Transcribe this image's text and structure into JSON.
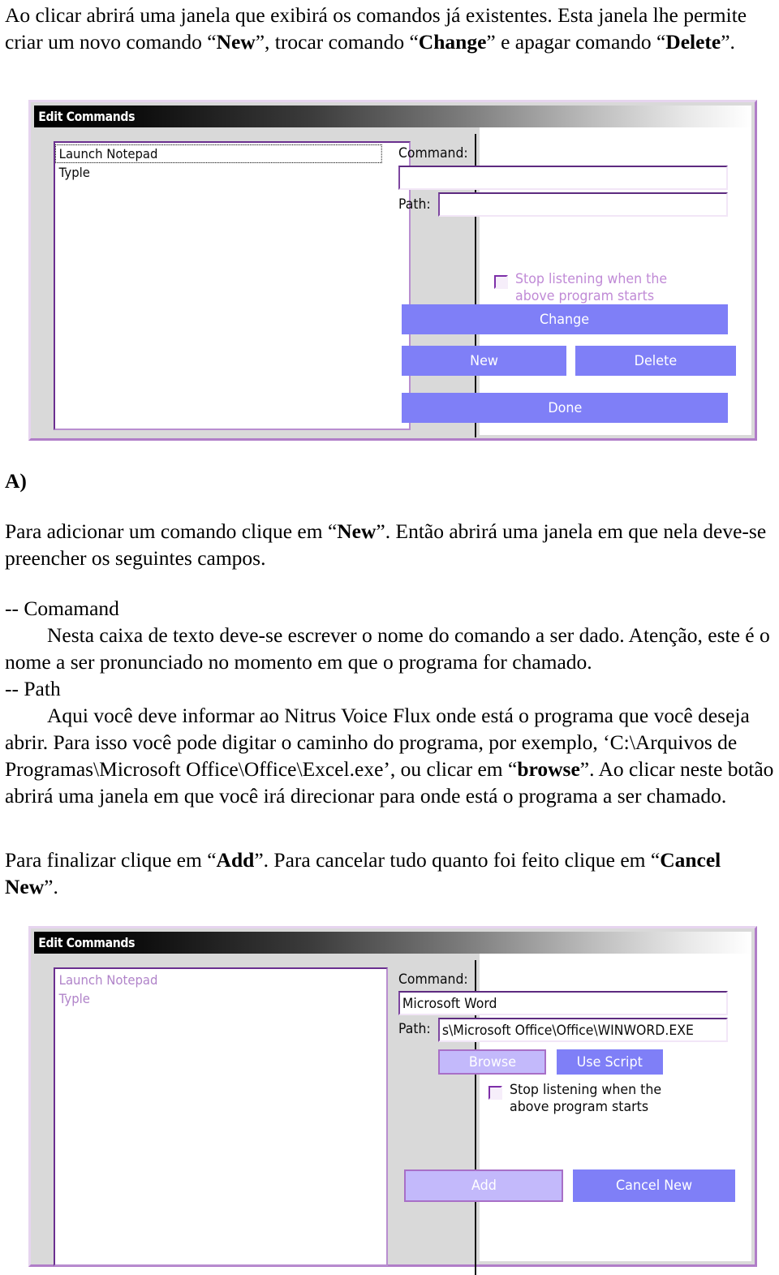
{
  "document": {
    "intro_paragraph": {
      "part1": "Ao clicar abrirá uma janela que exibirá os comandos já existentes. Esta janela lhe permite criar um novo comando “",
      "bold1": "New",
      "part2": "”, trocar comando “",
      "bold2": "Change",
      "part3": "” e apagar comando “",
      "bold3": "Delete",
      "part4": "”."
    },
    "section_a_label": "A)",
    "paragraph_b": {
      "part1": "Para adicionar um comando clique em “",
      "bold1": "New",
      "part2": "”. Então abrirá uma janela em que nela deve-se preencher os seguintes campos."
    },
    "paragraph_c": {
      "line_comamand": "-- Comamand",
      "comamand_body": "Nesta caixa de texto deve-se escrever o nome do comando a ser dado. Atenção, este é o nome a ser pronunciado no momento em que o programa for chamado.",
      "line_path": "-- Path",
      "path_body_part1": "Aqui você deve informar ao Nitrus Voice Flux onde está o programa que você deseja abrir. Para isso você pode digitar o caminho do programa, por exemplo, ‘C:\\Arquivos de Programas\\Microsoft Office\\Office\\Excel.exe’, ou clicar em “",
      "path_bold1": "browse",
      "path_body_part2": "”. Ao clicar neste botão abrirá uma janela em que você irá direcionar para onde está o programa a ser chamado."
    },
    "paragraph_d": {
      "part1": "Para finalizar clique em “",
      "bold1": "Add",
      "part2": "”. Para cancelar tudo quanto foi feito clique em “",
      "bold2": "Cancel New",
      "part3": "”."
    }
  },
  "dialog1": {
    "title": "Edit Commands",
    "list": [
      {
        "label": "Launch Notepad",
        "selected": true
      },
      {
        "label": "Typle",
        "selected": false
      }
    ],
    "command_label": "Command:",
    "command_value": "",
    "path_label": "Path:",
    "path_value": "",
    "checkbox_label_line1": "Stop listening when the",
    "checkbox_label_line2": "above program starts",
    "checkbox_checked": false,
    "buttons": {
      "change": "Change",
      "new": "New",
      "delete": "Delete",
      "done": "Done"
    }
  },
  "dialog2": {
    "title": "Edit Commands",
    "list": [
      {
        "label": "Launch Notepad",
        "selected": false
      },
      {
        "label": "Typle",
        "selected": false
      }
    ],
    "command_label": "Command:",
    "command_value": "Microsoft Word",
    "path_label": "Path:",
    "path_value": "s\\Microsoft Office\\Office\\WINWORD.EXE",
    "checkbox_label_line1": "Stop listening when the",
    "checkbox_label_line2": "above program starts",
    "checkbox_checked": false,
    "buttons": {
      "browse": "Browse",
      "use_script": "Use Script",
      "add": "Add",
      "cancel_new": "Cancel New"
    }
  },
  "colors": {
    "button_primary": "#7f7ff7",
    "button_light": "#c3b9fb",
    "accent_purple": "#b083c9",
    "dialog_face": "#d9d9d9",
    "window_border": "#e6d4ef"
  }
}
